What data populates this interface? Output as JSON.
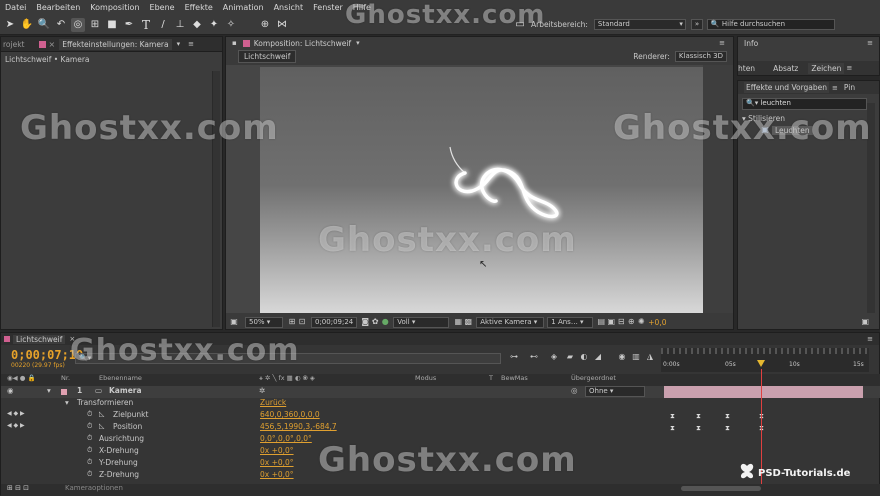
{
  "menubar": {
    "items": [
      "Datei",
      "Bearbeiten",
      "Komposition",
      "Ebene",
      "Effekte",
      "Animation",
      "Ansicht",
      "Fenster",
      "Hilfe"
    ]
  },
  "toolbar": {
    "workspace_label": "Arbeitsbereich:",
    "workspace_value": "Standard",
    "help_placeholder": "Hilfe durchsuchen"
  },
  "left_panel": {
    "tab_project": "rojekt",
    "tab_effects": "Effekteinstellungen: Kamera",
    "breadcrumb": "Lichtschweif • Kamera"
  },
  "comp_panel": {
    "tab": "Komposition: Lichtschweif",
    "comp_name": "Lichtschweif",
    "renderer_label": "Renderer:",
    "renderer_value": "Klassisch 3D",
    "zoom": "50%",
    "timecode": "0;00;09;24",
    "resolution": "Voll",
    "camera": "Aktive Kamera",
    "views": "1 Ans…",
    "exposure": "+0,0"
  },
  "right_panel": {
    "tab_info": "Info",
    "tab_ehten": "hten",
    "tab_absatz": "Absatz",
    "tab_zeichen": "Zeichen",
    "effects_tab": "Effekte und Vorgaben",
    "pin_tab": "Pin",
    "search_value": "leuchten",
    "category": "Stilisieren",
    "effect": "Leuchten"
  },
  "timeline": {
    "tab": "Lichtschweif",
    "timecode": "0;00;07;10",
    "frames": "00220 (29.97 fps)",
    "col_nr": "Nr.",
    "col_name": "Ebenenname",
    "col_mode": "Modus",
    "col_t": "T",
    "col_bewmas": "BewMas",
    "col_parent": "Übergeordnet",
    "ruler": [
      "0:00s",
      "05s",
      "10s",
      "15s"
    ],
    "layer": {
      "index": "1",
      "name": "Kamera",
      "parent": "Ohne"
    },
    "props": [
      {
        "name": "Transformieren",
        "value": "Zurück"
      },
      {
        "name": "Zielpunkt",
        "value": "640,0,360,0,0,0"
      },
      {
        "name": "Position",
        "value": "456,5,1990,3,-684,7"
      },
      {
        "name": "Ausrichtung",
        "value": "0,0°,0,0°,0,0°"
      },
      {
        "name": "X-Drehung",
        "value": "0x +0,0°"
      },
      {
        "name": "Y-Drehung",
        "value": "0x +0,0°"
      },
      {
        "name": "Z-Drehung",
        "value": "0x +0,0°"
      }
    ],
    "cut_label": "Kameraoptionen"
  },
  "watermark": {
    "text": "Ghostxx.com",
    "logo_text": "PSD-Tutorials.de"
  }
}
